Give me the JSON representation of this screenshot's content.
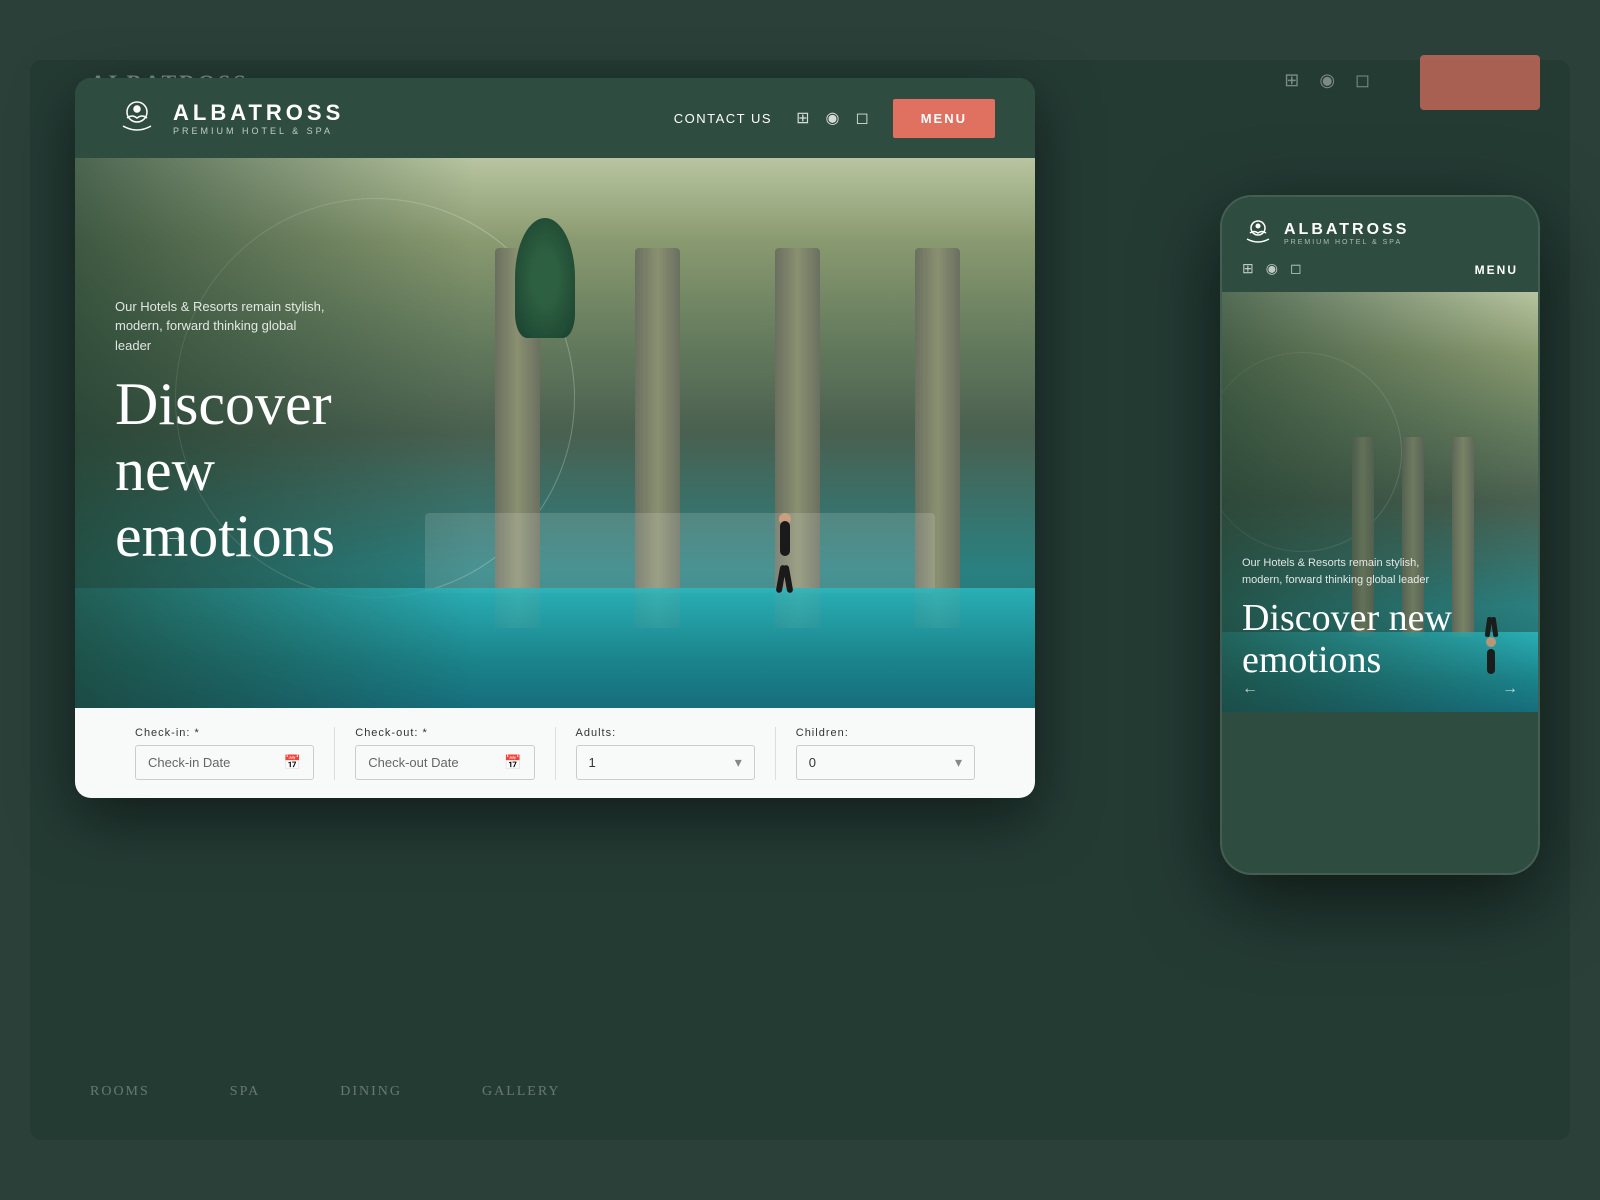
{
  "background": {
    "color": "#2d4a3e"
  },
  "desktop": {
    "header": {
      "logo_name": "ALBATROSS",
      "logo_subtitle": "PREMIUM HOTEL & SPA",
      "contact_label": "CONTACT US",
      "menu_label": "MENU"
    },
    "hero": {
      "subtitle": "Our Hotels & Resorts remain stylish, modern, forward thinking global leader",
      "title": "Discover new emotions",
      "arrow_left": "←",
      "arrow_right": "→"
    },
    "booking": {
      "checkin_label": "Check-in: *",
      "checkin_placeholder": "Check-in Date",
      "checkout_label": "Check-out: *",
      "checkout_placeholder": "Check-out Date",
      "adults_label": "Adults:",
      "adults_value": "1",
      "children_label": "Children:",
      "children_value": "0"
    }
  },
  "mobile": {
    "header": {
      "logo_name": "ALBATROSS",
      "logo_subtitle": "PREMIUM HOTEL & SPA",
      "menu_label": "MENU"
    },
    "hero": {
      "subtitle": "Our Hotels & Resorts remain stylish, modern, forward thinking global leader",
      "title_line1": "Discover new",
      "title_line2": "emotions",
      "arrow_left": "←",
      "arrow_right": "→"
    }
  },
  "colors": {
    "brand_dark": "#2e4d40",
    "accent_salmon": "#e07060",
    "white": "#ffffff",
    "pool_teal": "#2ab8c0"
  }
}
